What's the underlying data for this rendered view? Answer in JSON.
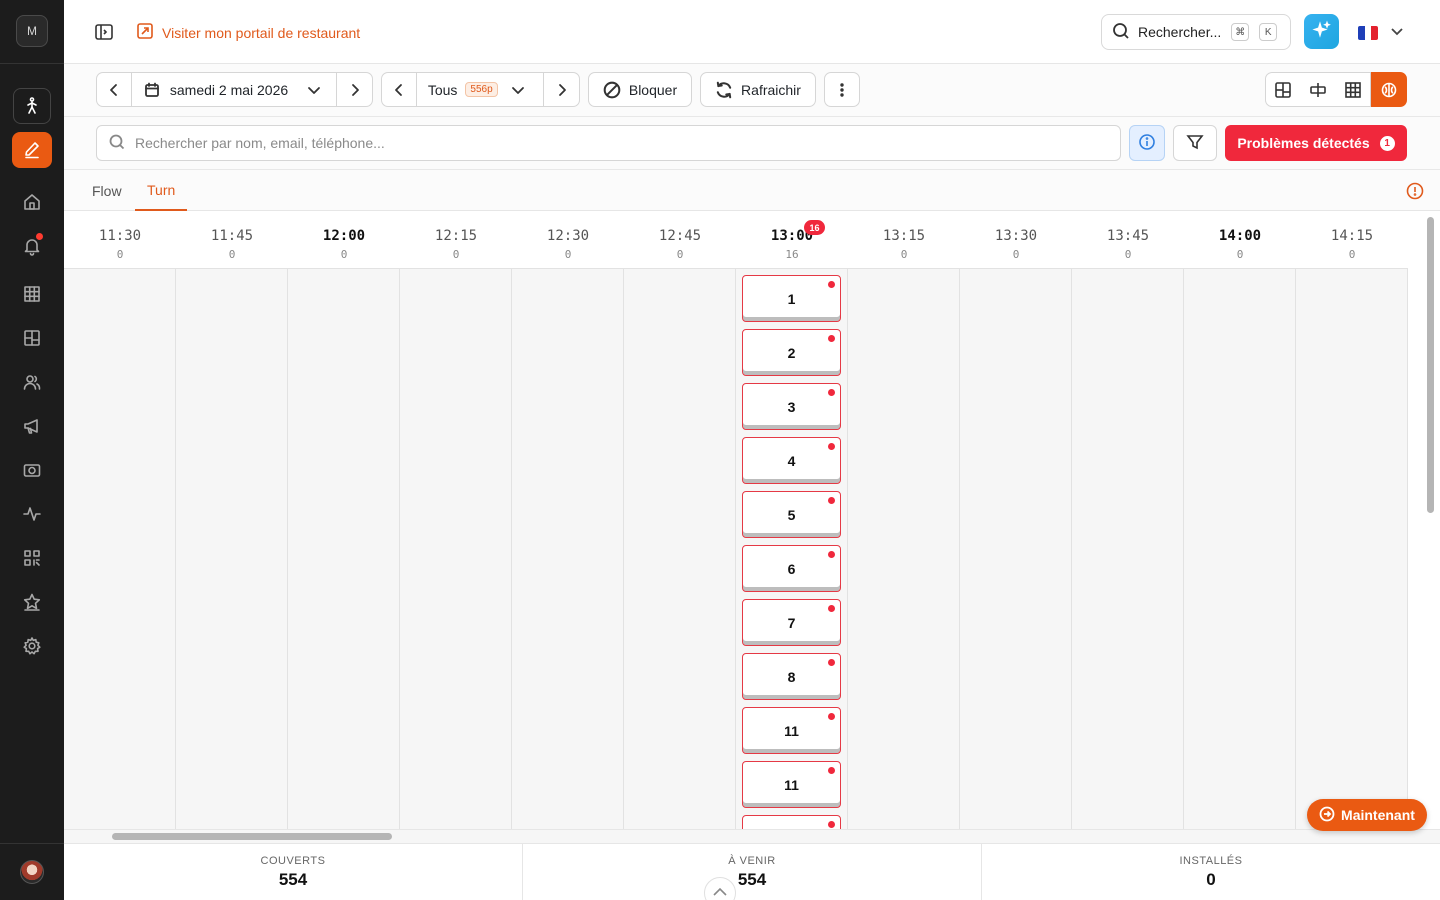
{
  "sidebar": {
    "workspace_initial": "M",
    "items": [
      {
        "icon": "walk-icon",
        "name": "sidebar-item-walkin",
        "state": "boxed"
      },
      {
        "icon": "pencil-icon",
        "name": "sidebar-item-reservations",
        "state": "active"
      },
      {
        "icon": "home-icon",
        "name": "sidebar-item-home",
        "state": ""
      },
      {
        "icon": "bell-icon",
        "name": "sidebar-item-notifications",
        "state": "dot"
      },
      {
        "icon": "grid-icon",
        "name": "sidebar-item-tables",
        "state": ""
      },
      {
        "icon": "layout-icon",
        "name": "sidebar-item-floorplan",
        "state": ""
      },
      {
        "icon": "users-icon",
        "name": "sidebar-item-customers",
        "state": ""
      },
      {
        "icon": "megaphone-icon",
        "name": "sidebar-item-marketing",
        "state": ""
      },
      {
        "icon": "camera-icon",
        "name": "sidebar-item-media",
        "state": ""
      },
      {
        "icon": "activity-icon",
        "name": "sidebar-item-analytics",
        "state": ""
      },
      {
        "icon": "qr-icon",
        "name": "sidebar-item-qrcode",
        "state": ""
      },
      {
        "icon": "star-icon",
        "name": "sidebar-item-reviews",
        "state": ""
      },
      {
        "icon": "gear-icon",
        "name": "sidebar-item-settings",
        "state": ""
      }
    ]
  },
  "header": {
    "portal_link": "Visiter mon portail de restaurant",
    "search_label": "Rechercher...",
    "shortcut_keys": [
      "⌘",
      "K"
    ],
    "language": "fr"
  },
  "toolbar": {
    "date": "samedi 2 mai 2026",
    "service": "Tous",
    "capacity": "556p",
    "block_label": "Bloquer",
    "refresh_label": "Rafraichir"
  },
  "search": {
    "placeholder": "Rechercher par nom, email, téléphone...",
    "problems_label": "Problèmes détectés",
    "problems_count": "1"
  },
  "tabs": [
    {
      "label": "Flow",
      "active": false
    },
    {
      "label": "Turn",
      "active": true
    }
  ],
  "timeline": {
    "slots": [
      {
        "time": "11:30",
        "covers": "0",
        "hour": false,
        "badge": ""
      },
      {
        "time": "11:45",
        "covers": "0",
        "hour": false,
        "badge": ""
      },
      {
        "time": "12:00",
        "covers": "0",
        "hour": true,
        "badge": ""
      },
      {
        "time": "12:15",
        "covers": "0",
        "hour": false,
        "badge": ""
      },
      {
        "time": "12:30",
        "covers": "0",
        "hour": false,
        "badge": ""
      },
      {
        "time": "12:45",
        "covers": "0",
        "hour": false,
        "badge": ""
      },
      {
        "time": "13:00",
        "covers": "16",
        "hour": true,
        "badge": "16"
      },
      {
        "time": "13:15",
        "covers": "0",
        "hour": false,
        "badge": ""
      },
      {
        "time": "13:30",
        "covers": "0",
        "hour": false,
        "badge": ""
      },
      {
        "time": "13:45",
        "covers": "0",
        "hour": false,
        "badge": ""
      },
      {
        "time": "14:00",
        "covers": "0",
        "hour": true,
        "badge": ""
      },
      {
        "time": "14:15",
        "covers": "0",
        "hour": false,
        "badge": ""
      }
    ],
    "reservation_slot": "13:00",
    "reservations": [
      "1",
      "2",
      "3",
      "4",
      "5",
      "6",
      "7",
      "8",
      "11",
      "11",
      ""
    ],
    "now_label": "Maintenant"
  },
  "stats": [
    {
      "label": "COUVERTS",
      "value": "554"
    },
    {
      "label": "À VENIR",
      "value": "554"
    },
    {
      "label": "INSTALLÉS",
      "value": "0"
    }
  ],
  "colors": {
    "accent": "#ea5a12",
    "alert": "#f0283c",
    "sidebar_bg": "#1c1c1c"
  }
}
